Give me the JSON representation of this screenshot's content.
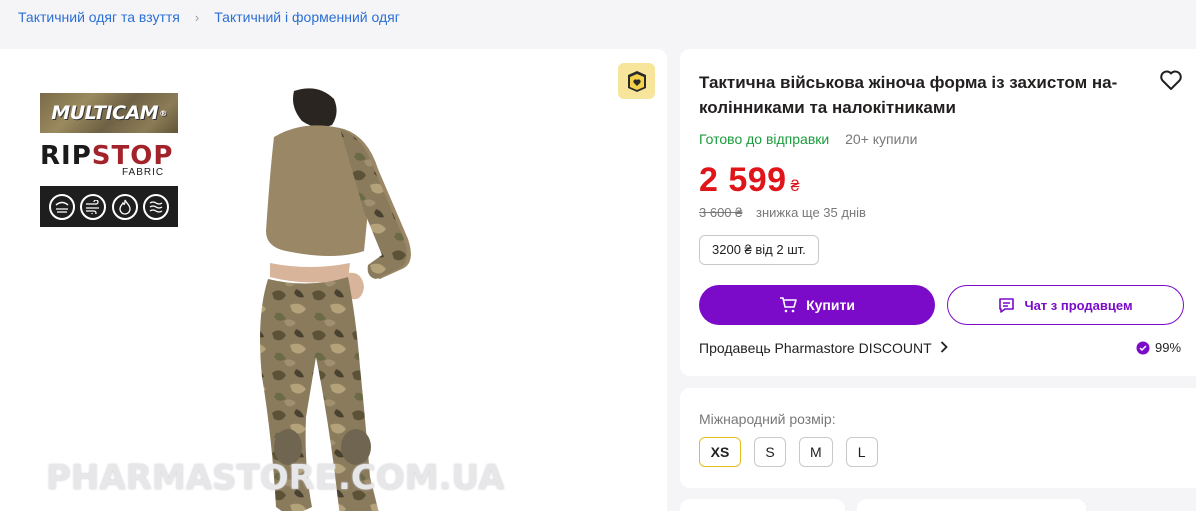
{
  "breadcrumb": {
    "items": [
      {
        "label": "Тактичний одяг та взуття"
      },
      {
        "label": "Тактичний і форменний одяг"
      }
    ],
    "separator": "›"
  },
  "gallery": {
    "brand_logo": "MULTICAM",
    "brand_logo_mark": "®",
    "fabric_logo_rip": "RIP",
    "fabric_logo_stop": "STOP",
    "fabric_logo_sub": "FABRIC",
    "watermark": "PHARMASTORE.COM.UA",
    "badge_icon": "box-heart-icon",
    "feature_icons": [
      "water-resistant-icon",
      "windproof-icon",
      "fire-resistant-icon",
      "breathable-icon"
    ]
  },
  "product": {
    "title": "Тактична військова жіноча форма із захистом на-колінниками та налокітниками",
    "status": "Готово до відправки",
    "bought": "20+ купили",
    "price": "2 599",
    "currency": "₴",
    "old_price": "3 600 ₴",
    "discount_note": "знижка ще 35 днів",
    "wholesale": "3200 ₴ від 2 шт.",
    "buy_label": "Купити",
    "chat_label": "Чат з продавцем",
    "seller": "Продавець Pharmastore DISCOUNT",
    "rating": "99%"
  },
  "sizes": {
    "label": "Міжнародний розмір:",
    "options": [
      "XS",
      "S",
      "M",
      "L"
    ],
    "selected": "XS"
  },
  "colors": {
    "accent": "#7b0ac9",
    "price": "#e0151a",
    "ready": "#1a9c3c",
    "link": "#2b6fd6",
    "selected_size_border": "#e3bf1f"
  }
}
